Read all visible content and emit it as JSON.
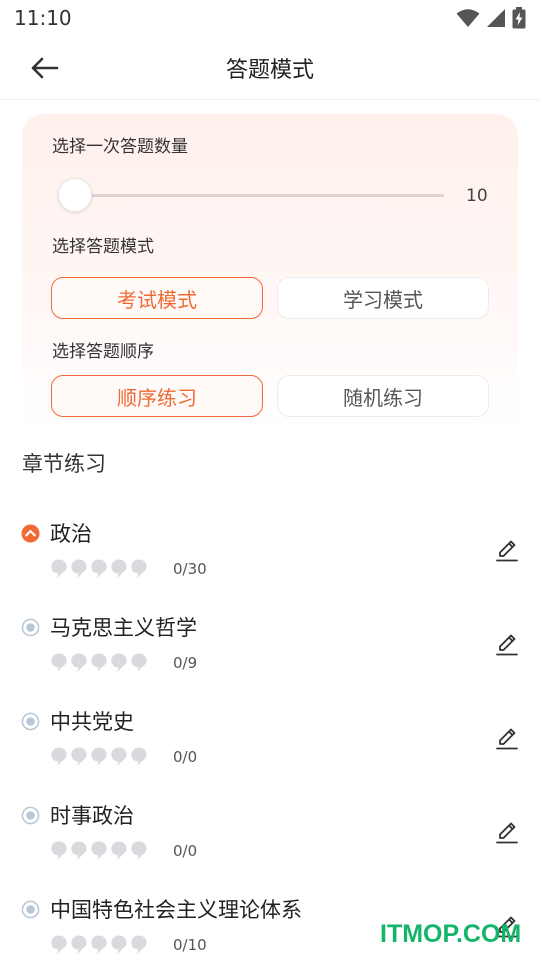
{
  "status_bar": {
    "time": "11:10"
  },
  "header": {
    "title": "答题模式"
  },
  "settings": {
    "count_label": "选择一次答题数量",
    "count_value": "10",
    "slider_fraction": 0.0,
    "mode_label": "选择答题模式",
    "modes": [
      {
        "label": "考试模式",
        "active": true
      },
      {
        "label": "学习模式",
        "active": false
      }
    ],
    "order_label": "选择答题顺序",
    "orders": [
      {
        "label": "顺序练习",
        "active": true
      },
      {
        "label": "随机练习",
        "active": false
      }
    ]
  },
  "chapters": {
    "heading": "章节练习",
    "items": [
      {
        "name": "政治",
        "progress": "0/30",
        "icon": "chevron-up-circle-icon",
        "expanded": true
      },
      {
        "name": "马克思主义哲学",
        "progress": "0/9",
        "icon": "radio-dot-icon",
        "expanded": false
      },
      {
        "name": "中共党史",
        "progress": "0/0",
        "icon": "radio-dot-icon",
        "expanded": false
      },
      {
        "name": "时事政治",
        "progress": "0/0",
        "icon": "radio-dot-icon",
        "expanded": false
      },
      {
        "name": "中国特色社会主义理论体系",
        "progress": "0/10",
        "icon": "radio-dot-icon",
        "expanded": false
      }
    ]
  },
  "colors": {
    "accent": "#f06a35",
    "star_empty": "#d9d9de",
    "radio": "#b8c7d6",
    "watermark": "#14b56a"
  },
  "watermark": "ITMOP.COM"
}
